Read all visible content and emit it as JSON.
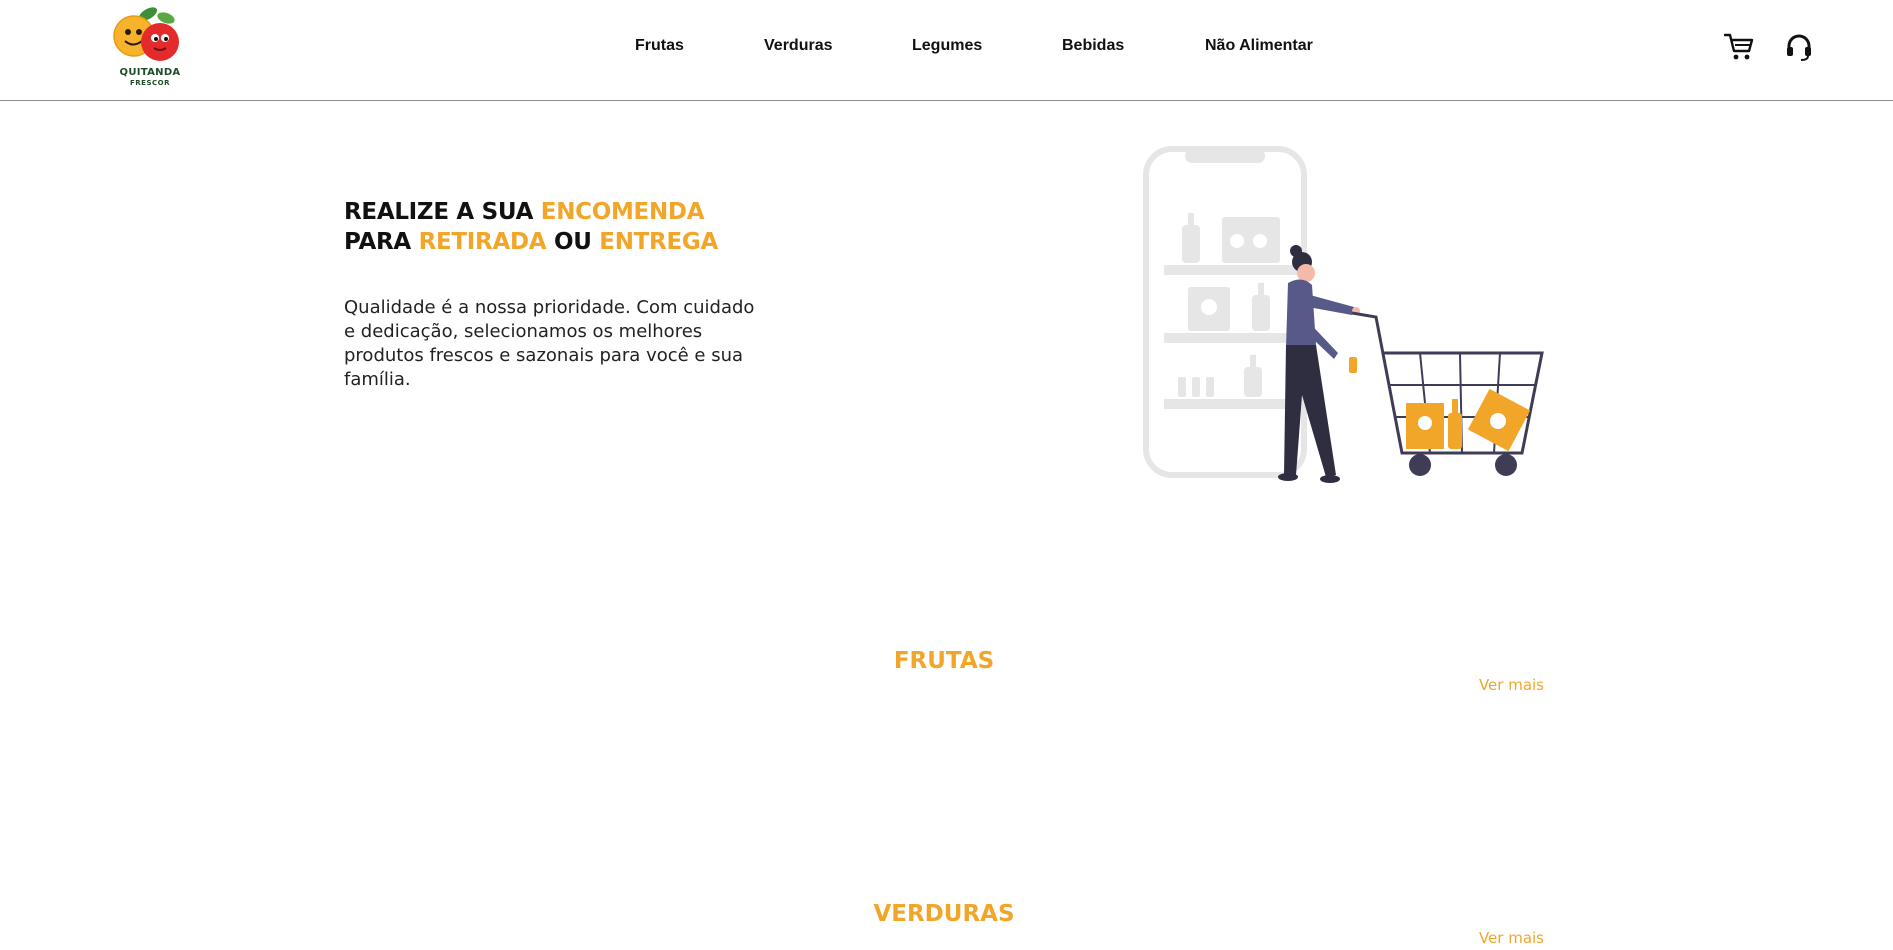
{
  "brand": {
    "logo_line1": "QUITANDA",
    "logo_line2": "FRESCOR"
  },
  "nav": {
    "items": [
      {
        "label": "Frutas"
      },
      {
        "label": "Verduras"
      },
      {
        "label": "Legumes"
      },
      {
        "label": "Bebidas"
      },
      {
        "label": "Não Alimentar"
      }
    ]
  },
  "header_icons": {
    "cart": "cart-icon",
    "support": "headset-icon"
  },
  "hero": {
    "title_part1": "REALIZE A SUA ",
    "title_highlight1": "ENCOMENDA",
    "title_part2": "PARA ",
    "title_highlight2": "RETIRADA",
    "title_part3": " OU ",
    "title_highlight3": "ENTREGA",
    "description": "Qualidade é a nossa prioridade. Com cuidado e dedicação, selecionamos os melhores produtos frescos e sazonais para você e sua família."
  },
  "sections": [
    {
      "title": "FRUTAS",
      "link": "Ver mais"
    },
    {
      "title": "VERDURAS",
      "link": "Ver mais"
    }
  ],
  "colors": {
    "accent": "#f2a629",
    "text": "#111111",
    "divider": "#8d8d8d",
    "illustration_gray": "#e6e6e6",
    "illustration_dark": "#2f2e41",
    "illustration_purple": "#575a89"
  }
}
